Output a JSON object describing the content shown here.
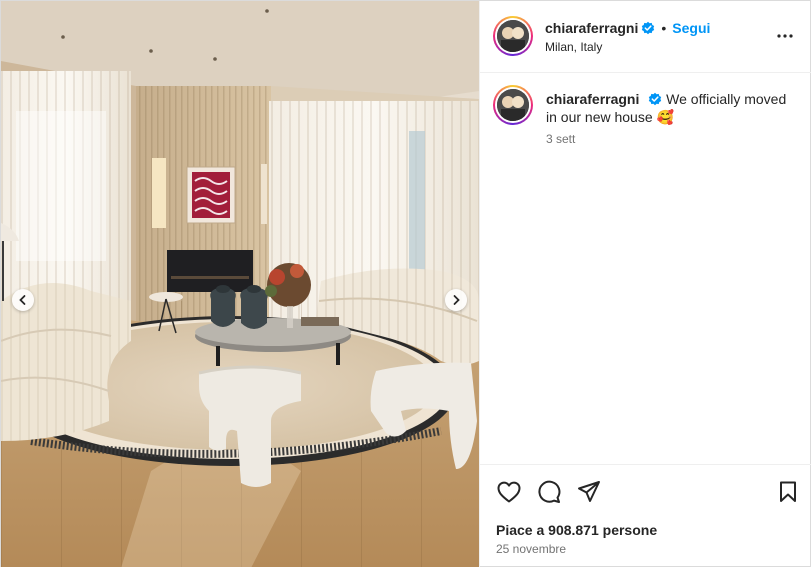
{
  "post": {
    "username": "chiaraferragni",
    "follow_label": "Segui",
    "dot": "•",
    "location": "Milan, Italy",
    "caption_text": "We officially moved in our new house 🥰",
    "caption_time": "3 sett",
    "likes_text": "Piace a 908.871 persone",
    "date_text": "25 novembre"
  },
  "icons": {
    "verified": "verified-badge-icon",
    "more": "more-options-icon",
    "like": "heart-icon",
    "comment": "comment-icon",
    "share": "share-icon",
    "save": "bookmark-icon",
    "prev": "chevron-left-icon",
    "next": "chevron-right-icon"
  },
  "colors": {
    "link_blue": "#0095f6",
    "verified_blue": "#0095f6",
    "text": "#262626",
    "secondary": "#737373"
  }
}
